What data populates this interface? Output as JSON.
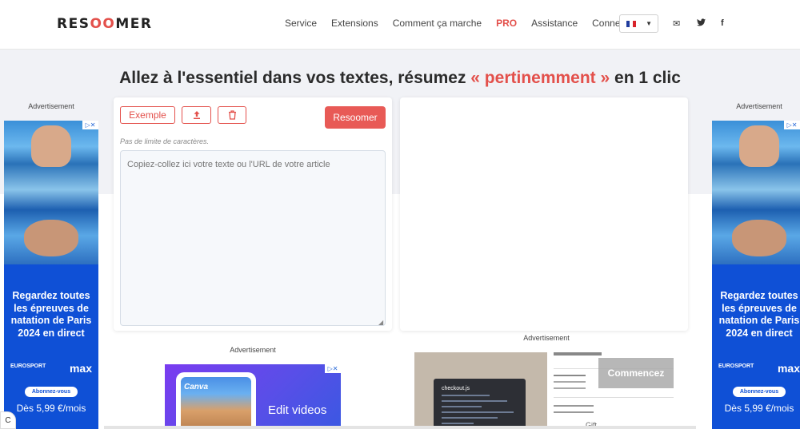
{
  "header": {
    "logo_prefix": "RES",
    "logo_mid": "OO",
    "logo_suffix": "MER",
    "nav": [
      "Service",
      "Extensions",
      "Comment ça marche",
      "PRO",
      "Assistance",
      "Connexion"
    ],
    "lang_flag_colors": [
      "#1f3c9e",
      "#ffffff",
      "#d8232a"
    ],
    "icons": [
      "envelope-icon",
      "twitter-icon",
      "facebook-icon"
    ]
  },
  "hero": {
    "tagline_before": "Allez à l'essentiel dans vos textes, résumez ",
    "tagline_highlight": "« pertinemment »",
    "tagline_after": " en 1 clic"
  },
  "tool": {
    "example_label": "Exemple",
    "upload_icon": "upload-icon",
    "trash_icon": "trash-icon",
    "summarize_label": "Resoomer",
    "limit_text": "Pas de limite de caractères.",
    "input_placeholder": "Copiez-collez ici votre texte ou l'URL de votre article"
  },
  "ads": {
    "label": "Advertisement",
    "side": {
      "headline": "Regardez toutes les épreuves de natation de Paris 2024 en direct",
      "brand_left": "EUROSPORT",
      "brand_right": "max",
      "cta": "Abonnez-vous",
      "price": "Dès 5,99 €/mois"
    },
    "canva": {
      "logo": "Canva",
      "text": "Edit videos"
    },
    "wix": {
      "file_name": "checkout.js",
      "button": "Commencez",
      "gift": "Gift"
    }
  },
  "cookie_button": "C",
  "theme": {
    "accent": "#e3504b",
    "ad_blue": "#0f50d6"
  }
}
